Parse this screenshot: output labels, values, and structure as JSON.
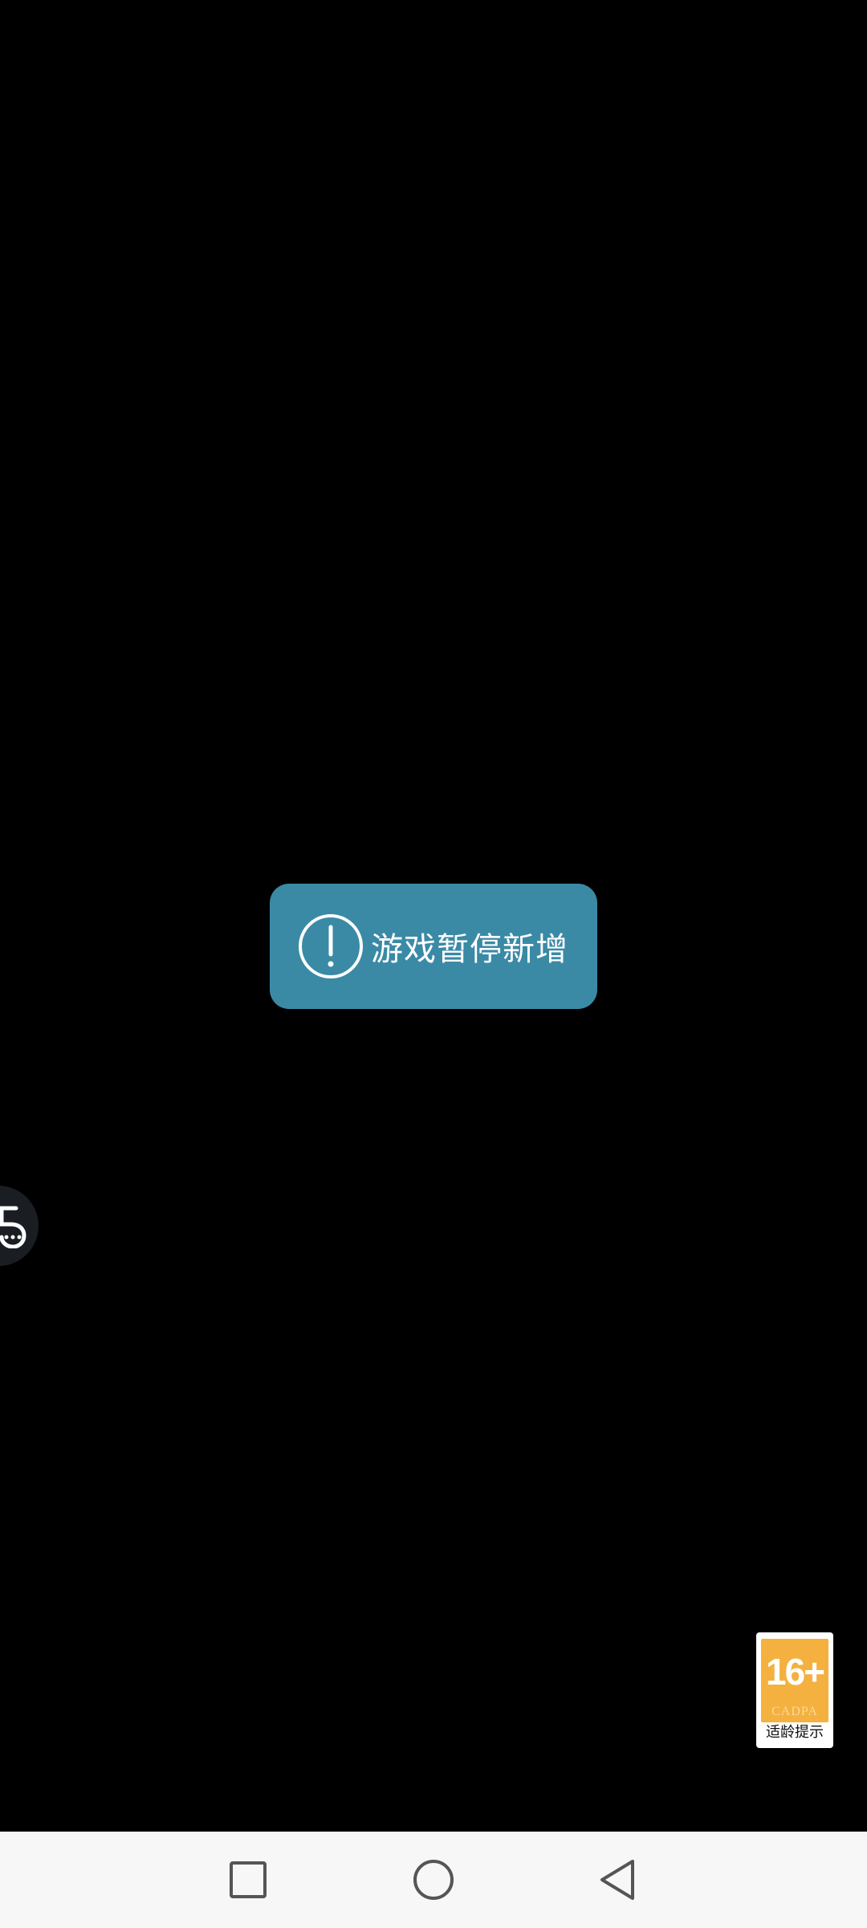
{
  "toast": {
    "message": "游戏暂停新增",
    "icon": "exclamation-circle-icon",
    "background": "#3a8aa6"
  },
  "floating_ball": {
    "icon": "assistant-chat-icon"
  },
  "age_rating": {
    "rating": "16+",
    "organization": "CADPA",
    "caption": "适龄提示",
    "color": "#f4b13f"
  },
  "navbar": {
    "recents_icon": "square-icon",
    "home_icon": "circle-icon",
    "back_icon": "triangle-back-icon",
    "background": "#f7f7f7"
  }
}
